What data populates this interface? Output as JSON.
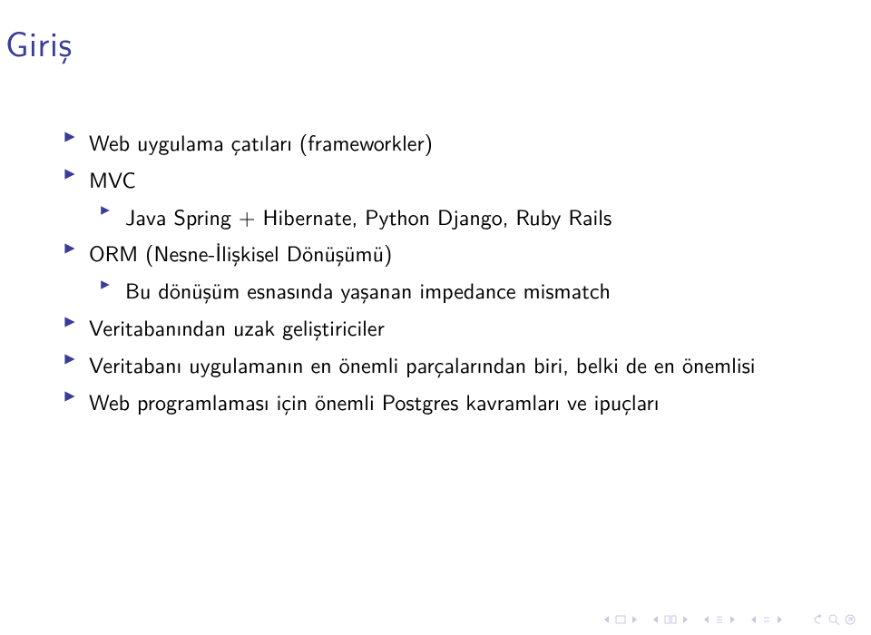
{
  "title": "Giriş",
  "bullets": [
    {
      "level": 1,
      "text": "Web uygulama çatıları (frameworkler)"
    },
    {
      "level": 1,
      "text": "MVC"
    },
    {
      "level": 2,
      "text": "Java Spring + Hibernate, Python Django, Ruby Rails"
    },
    {
      "level": 1,
      "text": "ORM (Nesne-İlişkisel Dönüşümü)"
    },
    {
      "level": 2,
      "text": "Bu dönüşüm esnasında yaşanan impedance mismatch"
    },
    {
      "level": 1,
      "text": "Veritabanından uzak geliştiriciler"
    },
    {
      "level": 1,
      "text": "Veritabanı uygulamanın en önemli parçalarından biri, belki de en önemlisi"
    },
    {
      "level": 1,
      "text": "Web programlaması için önemli Postgres kavramları ve ipuçları"
    }
  ],
  "colors": {
    "title": "#3a3c99",
    "bullet": "#3a3c99",
    "nav": "#b8b9d9"
  }
}
